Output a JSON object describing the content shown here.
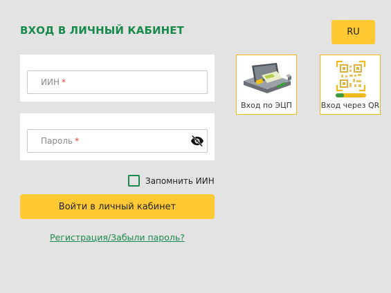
{
  "header": {
    "title": "ВХОД В ЛИЧНЫЙ КАБИНЕТ",
    "language": "RU"
  },
  "form": {
    "iin_placeholder": "ИИН",
    "password_placeholder": "Пароль",
    "required_mark": "*",
    "remember_label": "Запомнить ИИН",
    "remember_checked": false,
    "login_button": "Войти в личный кабинет",
    "register_link": "Регистрация/Забыли пароль?"
  },
  "auth_options": [
    {
      "label": "Вход по ЭЦП",
      "icon": "ecp-reader-icon"
    },
    {
      "label": "Вход через QR",
      "icon": "qr-code-icon"
    }
  ],
  "colors": {
    "accent_green": "#1a8a4c",
    "accent_yellow": "#ffc933",
    "tile_border": "#f0b91a",
    "background": "#e3e3e3",
    "required": "#e23b3b"
  }
}
